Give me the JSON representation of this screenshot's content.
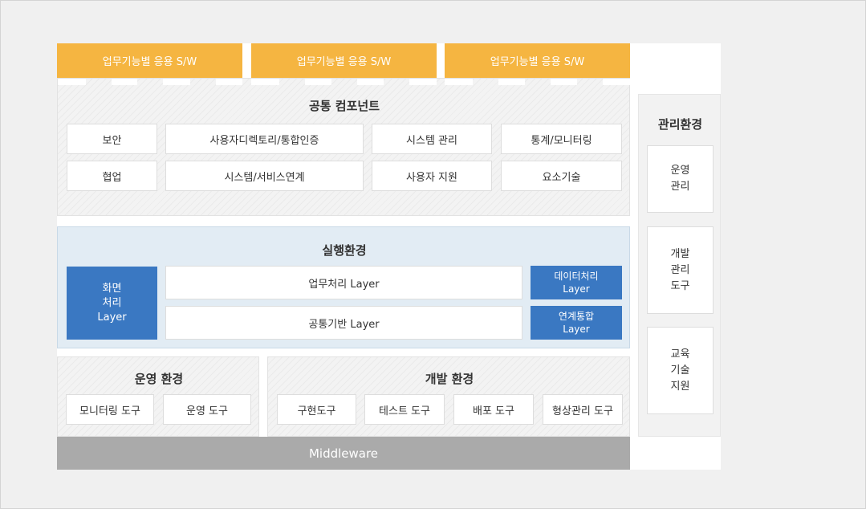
{
  "app_sw": [
    "업무기능별 응용 S/W",
    "업무기능별 응용 S/W",
    "업무기능별 응용 S/W"
  ],
  "common": {
    "title": "공통 컴포넌트",
    "row1": [
      "보안",
      "사용자디렉토리/통합인증",
      "시스템 관리",
      "통계/모니터링"
    ],
    "row2": [
      "협업",
      "시스템/서비스연계",
      "사용자 지원",
      "요소기술"
    ]
  },
  "exec": {
    "title": "실행환경",
    "screen": [
      "화면",
      "처리",
      "Layer"
    ],
    "business_layer": "업무처리 Layer",
    "common_layer": "공통기반 Layer",
    "data_layer": [
      "데이터처리",
      "Layer"
    ],
    "integration_layer": [
      "연계통합",
      "Layer"
    ]
  },
  "ops_env": {
    "title": "운영 환경",
    "tools": [
      "모니터링 도구",
      "운영 도구"
    ]
  },
  "dev_env": {
    "title": "개발 환경",
    "tools": [
      "구현도구",
      "테스트 도구",
      "배포 도구",
      "형상관리 도구"
    ]
  },
  "middleware": "Middleware",
  "mgmt": {
    "title": "관리환경",
    "ops": [
      "운영",
      "관리"
    ],
    "dev": [
      "개발",
      "관리",
      "도구"
    ],
    "edu": [
      "교육",
      "기술",
      "지원"
    ]
  },
  "colors": {
    "orange": "#f5b541",
    "blue": "#3a78c2",
    "exec_bg": "#e2ecf4",
    "middleware": "#aaaaaa"
  }
}
